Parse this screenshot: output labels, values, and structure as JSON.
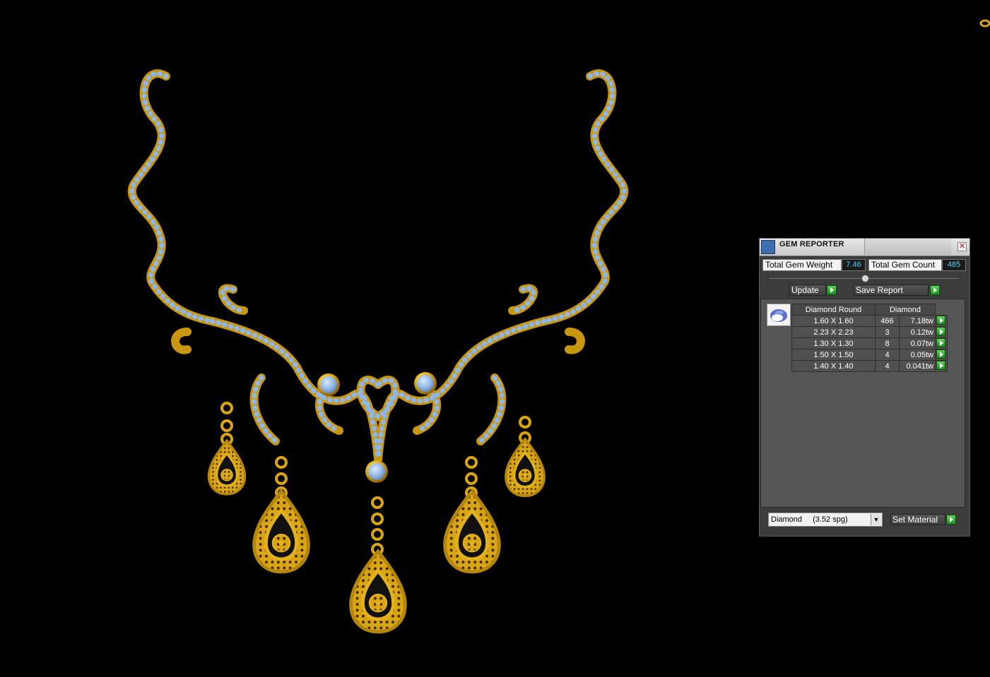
{
  "panel": {
    "title": "GEM REPORTER",
    "close_icon": "close-icon",
    "total_gem_weight_label": "Total Gem Weight",
    "total_gem_weight_value": "7.46",
    "total_gem_count_label": "Total Gem Count",
    "total_gem_count_value": "485",
    "update_label": "Update",
    "save_report_label": "Save Report",
    "table": {
      "headers": [
        "Diamond Round",
        "Diamond"
      ],
      "rows": [
        {
          "size": "1.60 X 1.60",
          "count": "466",
          "weight": "7.18tw"
        },
        {
          "size": "2.23 X 2.23",
          "count": "3",
          "weight": "0.12tw"
        },
        {
          "size": "1.30 X 1.30",
          "count": "8",
          "weight": "0.07tw"
        },
        {
          "size": "1.50 X 1.50",
          "count": "4",
          "weight": "0.05tw"
        },
        {
          "size": "1.40 X 1.40",
          "count": "4",
          "weight": "0.041tw"
        }
      ]
    },
    "material_select": {
      "name": "Diamond",
      "spg": "(3.52 spg)"
    },
    "set_material_label": "Set Material"
  },
  "colors": {
    "background": "#000000",
    "gold": "#d9a514",
    "gold_dark": "#8a5e05",
    "stone_blue": "#8fb6e6",
    "value_cyan": "#4fd1ff",
    "play_green": "#3ab53a"
  }
}
